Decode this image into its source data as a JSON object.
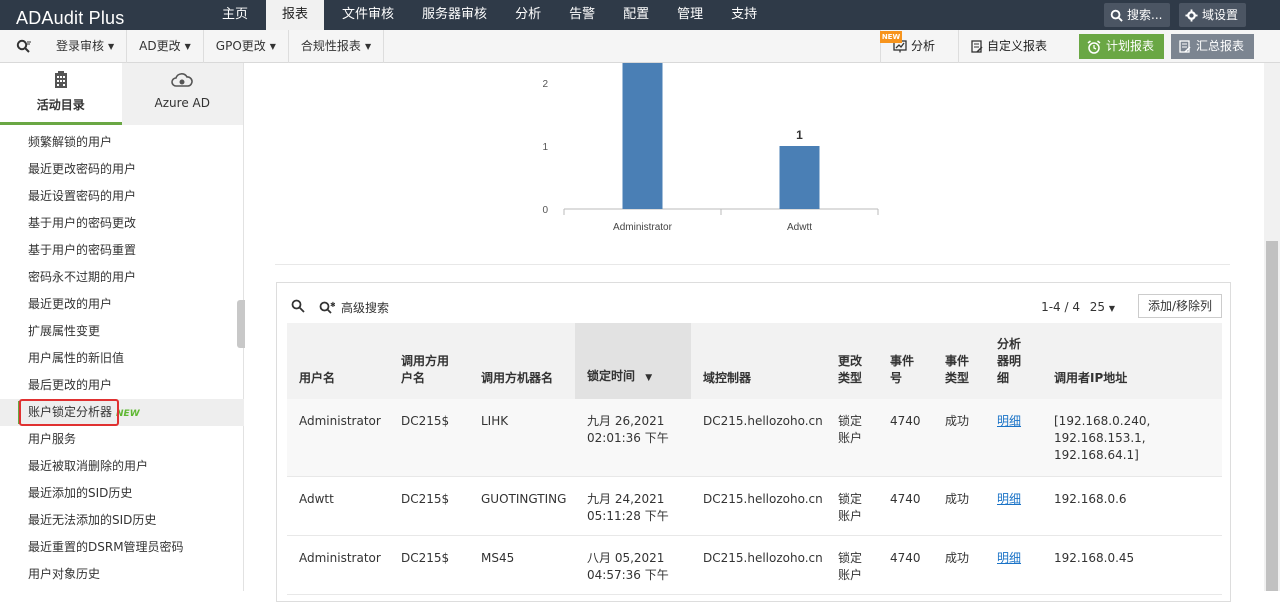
{
  "app": {
    "title": "ADAudit Plus"
  },
  "nav": {
    "items": [
      {
        "label": "主页",
        "active": false
      },
      {
        "label": "报表",
        "active": true
      },
      {
        "label": "文件审核",
        "active": false
      },
      {
        "label": "服务器审核",
        "active": false
      },
      {
        "label": "分析",
        "active": false
      },
      {
        "label": "告警",
        "active": false
      },
      {
        "label": "配置",
        "active": false
      },
      {
        "label": "管理",
        "active": false
      },
      {
        "label": "支持",
        "active": false
      }
    ],
    "search_label": "搜索...",
    "domain_settings_label": "域设置"
  },
  "subbar": {
    "menus": [
      "登录审核",
      "AD更改",
      "GPO更改",
      "合规性报表"
    ],
    "analyze_label": "分析",
    "analyze_badge": "NEW",
    "custom_report_label": "自定义报表",
    "scheduled_report_label": "计划报表",
    "summary_report_label": "汇总报表"
  },
  "sidebar": {
    "tabs": [
      {
        "label": "活动目录",
        "icon": "building-icon",
        "active": true
      },
      {
        "label": "Azure AD",
        "icon": "cloud-icon",
        "active": false
      }
    ],
    "items": [
      {
        "label": "频繁解锁的用户"
      },
      {
        "label": "最近更改密码的用户"
      },
      {
        "label": "最近设置密码的用户"
      },
      {
        "label": "基于用户的密码更改"
      },
      {
        "label": "基于用户的密码重置"
      },
      {
        "label": "密码永不过期的用户"
      },
      {
        "label": "最近更改的用户"
      },
      {
        "label": "扩展属性变更"
      },
      {
        "label": "用户属性的新旧值"
      },
      {
        "label": "最后更改的用户"
      },
      {
        "label": "账户锁定分析器",
        "badge": "NEW",
        "selected": true
      },
      {
        "label": "用户服务"
      },
      {
        "label": "最近被取消删除的用户"
      },
      {
        "label": "最近添加的SID历史"
      },
      {
        "label": "最近无法添加的SID历史"
      },
      {
        "label": "最近重置的DSRM管理员密码"
      },
      {
        "label": "用户对象历史"
      }
    ]
  },
  "chart_data": {
    "type": "bar",
    "categories": [
      "Administrator",
      "Adwtt"
    ],
    "values": [
      2.5,
      1
    ],
    "data_labels": [
      "",
      "1"
    ],
    "yticks": [
      "0",
      "1",
      "2"
    ],
    "ylim": [
      0,
      2
    ],
    "color": "#4a7fb5"
  },
  "table": {
    "tools": {
      "advanced_search_label": "高级搜索",
      "pager_label": "1-4 / 4",
      "per_page": "25",
      "columns_button_label": "添加/移除列"
    },
    "columns": [
      "用户名",
      "调用方用户名",
      "调用方机器名",
      "锁定时间",
      "域控制器",
      "更改类型",
      "事件号",
      "事件类型",
      "分析器明细",
      "调用者IP地址"
    ],
    "rows": [
      {
        "user": "Administrator",
        "caller_user": "DC215$",
        "caller_machine": "LIHK",
        "lock_time_date": "九月 26,2021",
        "lock_time_clock": "02:01:36 下午",
        "dc": "DC215.hellozoho.cn",
        "change_type": "锁定账户",
        "event_id": "4740",
        "event_type": "成功",
        "detail": "明细",
        "ip_lines": [
          "[192.168.0.240,",
          "192.168.153.1,",
          "192.168.64.1]"
        ]
      },
      {
        "user": "Adwtt",
        "caller_user": "DC215$",
        "caller_machine": "GUOTINGTING",
        "lock_time_date": "九月 24,2021",
        "lock_time_clock": "05:11:28 下午",
        "dc": "DC215.hellozoho.cn",
        "change_type": "锁定账户",
        "event_id": "4740",
        "event_type": "成功",
        "detail": "明细",
        "ip_lines": [
          "192.168.0.6"
        ]
      },
      {
        "user": "Administrator",
        "caller_user": "DC215$",
        "caller_machine": "MS45",
        "lock_time_date": "八月 05,2021",
        "lock_time_clock": "04:57:36 下午",
        "dc": "DC215.hellozoho.cn",
        "change_type": "锁定账户",
        "event_id": "4740",
        "event_type": "成功",
        "detail": "明细",
        "ip_lines": [
          "192.168.0.45"
        ]
      }
    ]
  }
}
